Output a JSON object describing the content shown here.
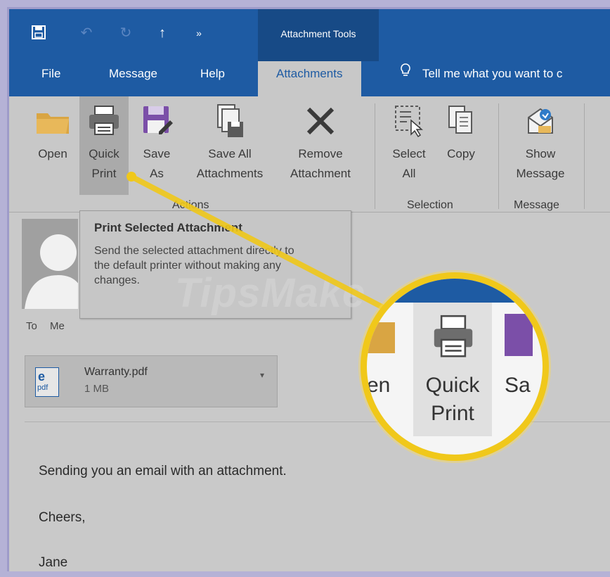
{
  "titlebar": {
    "contextual_title": "Attachment Tools",
    "qat_icons": [
      "save-icon",
      "undo-icon",
      "redo-icon",
      "up-arrow-icon",
      "more-icon"
    ]
  },
  "tabs": {
    "file": "File",
    "message": "Message",
    "help": "Help",
    "attachments": "Attachments",
    "tell_me": "Tell me what you want to c"
  },
  "ribbon": {
    "open": "Open",
    "quick_print": [
      "Quick",
      "Print"
    ],
    "save_as": [
      "Save",
      "As"
    ],
    "save_all": [
      "Save All",
      "Attachments"
    ],
    "remove": [
      "Remove",
      "Attachment"
    ],
    "actions_group": "Actions",
    "select_all": [
      "Select",
      "All"
    ],
    "copy": "Copy",
    "selection_group": "Selection",
    "show_message": [
      "Show",
      "Message"
    ],
    "message_group": "Message"
  },
  "tooltip": {
    "title": "Print Selected Attachment",
    "body": "Send the selected attachment directly to the default printer without making any changes."
  },
  "message": {
    "to_label": "To",
    "to_value": "Me",
    "attachment_name": "Warranty.pdf",
    "attachment_size": "1 MB",
    "attachment_type": "pdf",
    "lines": [
      "Sending you an email with an attachment.",
      "Cheers,",
      "Jane"
    ]
  },
  "zoom": {
    "left_partial": "en",
    "quick_print": [
      "Quick",
      "Print"
    ],
    "right_partial": "Sa"
  },
  "watermark": "TipsMake",
  "colors": {
    "ribbon_blue": "#1e5ba3",
    "highlight_yellow": "#f0c81a",
    "ribbon_bg": "#c8c8c8"
  }
}
